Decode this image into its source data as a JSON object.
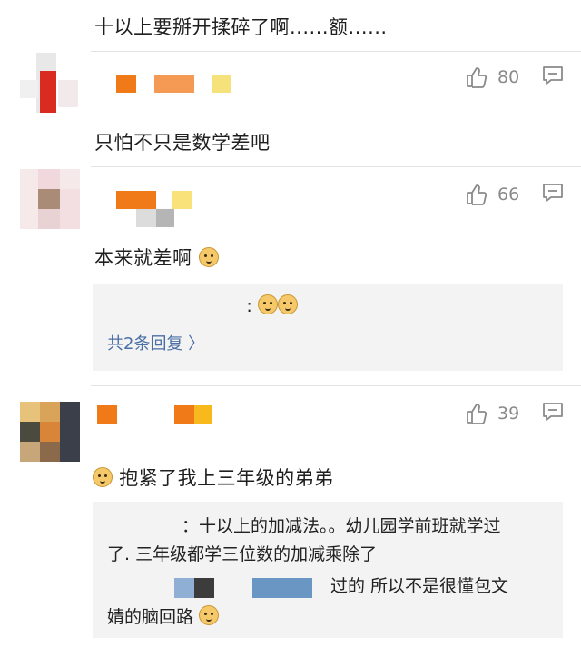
{
  "comments": [
    {
      "text": "十以上要掰开揉碎了啊......额......"
    },
    {
      "likes": "80",
      "text": "只怕不只是数学差吧"
    },
    {
      "likes": "66",
      "text": "本来就差啊"
    },
    {
      "reply_preview": ":",
      "more_replies": "共2条回复 〉"
    },
    {
      "likes": "39",
      "text": "抱紧了我上三年级的弟弟"
    }
  ],
  "reply_thread": {
    "line1": "：十以上的加减法。。幼儿园学前班就学过",
    "line2": "了. 三年级都学三位数的加减乘除了",
    "line3": "过的 所以不是很懂包文",
    "line4": "婧的脑回路"
  },
  "icons": {
    "like": "thumbs-up-icon",
    "comment": "comment-bubble-icon",
    "emoji": "doge-emoji-icon"
  },
  "colors": {
    "accent_link": "#4a6fa5",
    "muted": "#8a8a8a"
  }
}
